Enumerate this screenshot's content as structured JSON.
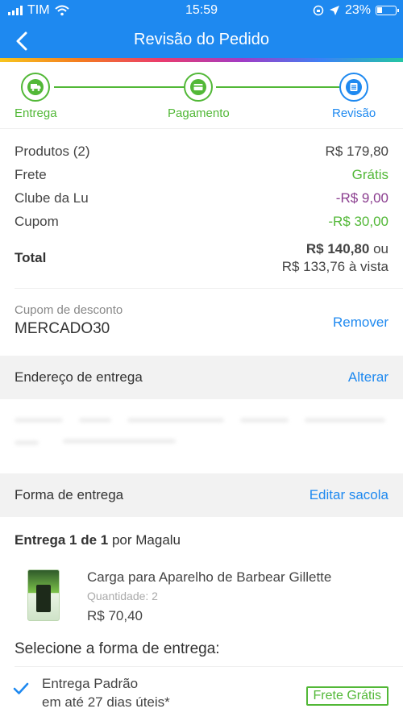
{
  "status_bar": {
    "carrier": "TIM",
    "time": "15:59",
    "battery": "23%"
  },
  "header": {
    "title": "Revisão do Pedido"
  },
  "steps": [
    {
      "label": "Entrega",
      "icon": "truck-icon",
      "state": "done"
    },
    {
      "label": "Pagamento",
      "icon": "card-icon",
      "state": "done"
    },
    {
      "label": "Revisão",
      "icon": "document-icon",
      "state": "active"
    }
  ],
  "summary": {
    "products_label": "Produtos (2)",
    "products_value": "R$ 179,80",
    "shipping_label": "Frete",
    "shipping_value": "Grátis",
    "club_label": "Clube da Lu",
    "club_value": "-R$ 9,00",
    "coupon_label": "Cupom",
    "coupon_value": "-R$ 30,00",
    "total_label": "Total",
    "total_value": "R$ 140,80",
    "total_or": "ou",
    "total_cash": "R$ 133,76 à vista"
  },
  "coupon": {
    "label": "Cupom de desconto",
    "code": "MERCADO30",
    "remove_label": "Remover"
  },
  "address_section": {
    "label": "Endereço de entrega",
    "action": "Alterar"
  },
  "delivery_section": {
    "label": "Forma de entrega",
    "action": "Editar sacola"
  },
  "delivery": {
    "head_bold": "Entrega 1 de 1",
    "head_rest": "por Magalu",
    "product": {
      "name": "Carga para Aparelho de Barbear Gillette",
      "quantity": "Quantidade: 2",
      "price": "R$ 70,40"
    },
    "select_title": "Selecione a forma de entrega:",
    "option": {
      "title": "Entrega Padrão",
      "subtitle": "em até 27 dias úteis*",
      "badge": "Frete Grátis",
      "selected": true
    }
  },
  "colors": {
    "primary": "#1e89f0",
    "success": "#52b837",
    "club": "#8a3d8f"
  }
}
